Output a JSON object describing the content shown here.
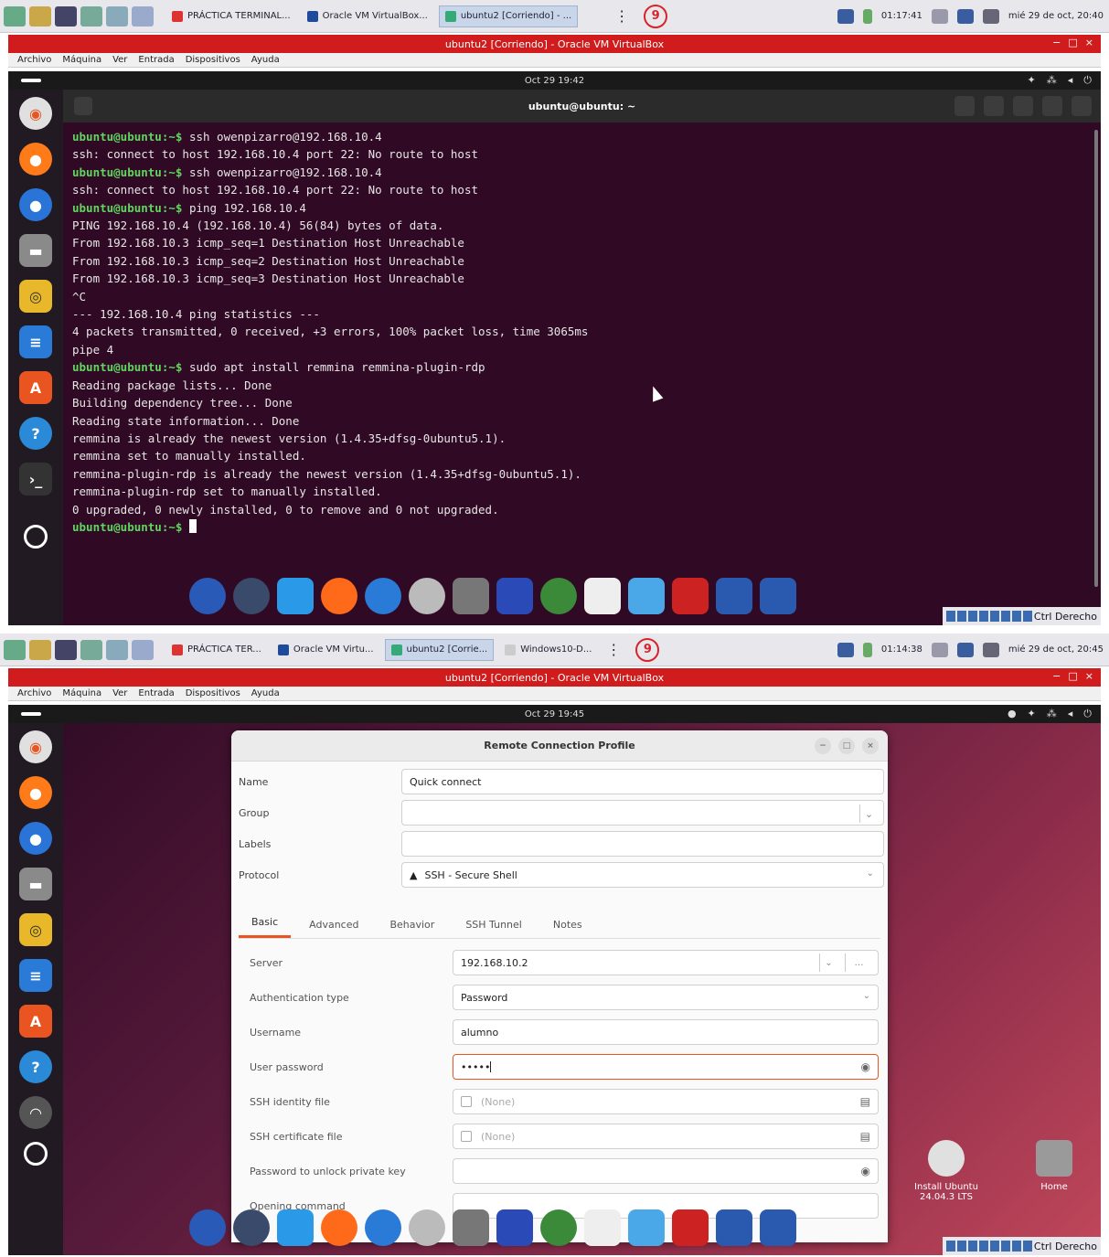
{
  "host": {
    "shot1_tabs": [
      "PRÁCTICA TERMINAL...",
      "Oracle VM VirtualBox...",
      "ubuntu2 [Corriendo] - ..."
    ],
    "shot2_tabs": [
      "PRÁCTICA TER...",
      "Oracle VM Virtu...",
      "ubuntu2 [Corrie...",
      "Windows10-D..."
    ],
    "badge": "9",
    "clock1": "01:17:41",
    "clock2": "01:14:38",
    "date": "mié 29 de oct, 20:40",
    "date2": "mié 29 de oct, 20:45"
  },
  "vbox": {
    "title": "ubuntu2 [Corriendo] - Oracle VM VirtualBox",
    "menu": [
      "Archivo",
      "Máquina",
      "Ver",
      "Entrada",
      "Dispositivos",
      "Ayuda"
    ],
    "win_buttons": [
      "−",
      "□",
      "×"
    ],
    "status_key": "Ctrl Derecho"
  },
  "gnome": {
    "clock1": "Oct 29 19:42",
    "clock2": "Oct 29 19:45"
  },
  "terminal": {
    "title": "ubuntu@ubuntu: ~",
    "lines": [
      {
        "prompt": "ubuntu@ubuntu:~$",
        "text": " ssh owenpizarro@192.168.10.4"
      },
      {
        "prompt": "",
        "text": "ssh: connect to host 192.168.10.4 port 22: No route to host"
      },
      {
        "prompt": "ubuntu@ubuntu:~$",
        "text": " ssh owenpizarro@192.168.10.4"
      },
      {
        "prompt": "",
        "text": "ssh: connect to host 192.168.10.4 port 22: No route to host"
      },
      {
        "prompt": "ubuntu@ubuntu:~$",
        "text": " ping 192.168.10.4"
      },
      {
        "prompt": "",
        "text": "PING 192.168.10.4 (192.168.10.4) 56(84) bytes of data."
      },
      {
        "prompt": "",
        "text": "From 192.168.10.3 icmp_seq=1 Destination Host Unreachable"
      },
      {
        "prompt": "",
        "text": "From 192.168.10.3 icmp_seq=2 Destination Host Unreachable"
      },
      {
        "prompt": "",
        "text": "From 192.168.10.3 icmp_seq=3 Destination Host Unreachable"
      },
      {
        "prompt": "",
        "text": "^C"
      },
      {
        "prompt": "",
        "text": "--- 192.168.10.4 ping statistics ---"
      },
      {
        "prompt": "",
        "text": "4 packets transmitted, 0 received, +3 errors, 100% packet loss, time 3065ms"
      },
      {
        "prompt": "",
        "text": "pipe 4"
      },
      {
        "prompt": "ubuntu@ubuntu:~$",
        "text": " sudo apt install remmina remmina-plugin-rdp"
      },
      {
        "prompt": "",
        "text": "Reading package lists... Done"
      },
      {
        "prompt": "",
        "text": "Building dependency tree... Done"
      },
      {
        "prompt": "",
        "text": "Reading state information... Done"
      },
      {
        "prompt": "",
        "text": "remmina is already the newest version (1.4.35+dfsg-0ubuntu5.1)."
      },
      {
        "prompt": "",
        "text": "remmina set to manually installed."
      },
      {
        "prompt": "",
        "text": "remmina-plugin-rdp is already the newest version (1.4.35+dfsg-0ubuntu5.1)."
      },
      {
        "prompt": "",
        "text": "remmina-plugin-rdp set to manually installed."
      },
      {
        "prompt": "",
        "text": "0 upgraded, 0 newly installed, 0 to remove and 0 not upgraded."
      },
      {
        "prompt": "ubuntu@ubuntu:~$",
        "text": " "
      }
    ]
  },
  "remmina": {
    "title": "Remote Connection Profile",
    "name_label": "Name",
    "name_value": "Quick connect",
    "group_label": "Group",
    "labels_label": "Labels",
    "protocol_label": "Protocol",
    "protocol_value": "SSH - Secure Shell",
    "tabs": [
      "Basic",
      "Advanced",
      "Behavior",
      "SSH Tunnel",
      "Notes"
    ],
    "fields": {
      "server_label": "Server",
      "server_value": "192.168.10.2",
      "auth_label": "Authentication type",
      "auth_value": "Password",
      "username_label": "Username",
      "username_value": "alumno",
      "password_label": "User password",
      "password_value": "•••••",
      "identity_label": "SSH identity file",
      "identity_placeholder": "(None)",
      "cert_label": "SSH certificate file",
      "cert_placeholder": "(None)",
      "unlock_label": "Password to unlock private key",
      "opening_label": "Opening command"
    }
  },
  "desktop": {
    "install_label": "Install Ubuntu 24.04.3 LTS",
    "home_label": "Home"
  },
  "colors": {
    "vbox_red": "#d01c1c",
    "ubuntu_orange": "#e95420",
    "terminal_bg": "#300a24",
    "prompt_green": "#5fd75f"
  }
}
